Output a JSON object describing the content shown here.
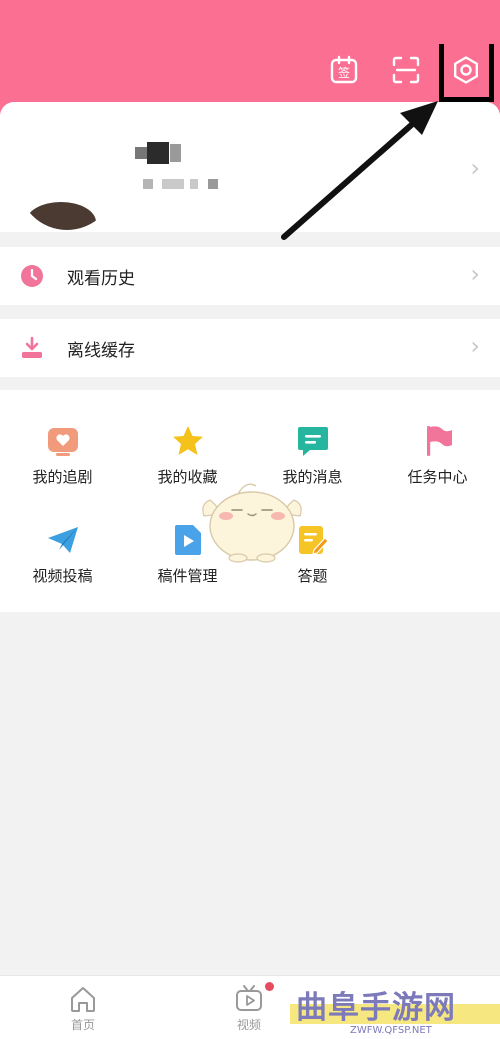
{
  "colors": {
    "accent": "#fb6f93",
    "watermark": "#7d7aba"
  },
  "header": {
    "icons": [
      "sign-in-calendar-icon",
      "scan-icon",
      "gear-icon"
    ]
  },
  "sign_in": {
    "glyph": "签"
  },
  "list": [
    {
      "label": "观看历史",
      "icon": "clock-icon"
    },
    {
      "label": "离线缓存",
      "icon": "download-icon"
    }
  ],
  "grid": [
    {
      "label": "我的追剧",
      "icon": "tv-heart-icon"
    },
    {
      "label": "我的收藏",
      "icon": "star-icon"
    },
    {
      "label": "我的消息",
      "icon": "message-icon"
    },
    {
      "label": "任务中心",
      "icon": "flag-icon"
    },
    {
      "label": "视频投稿",
      "icon": "paper-plane-icon"
    },
    {
      "label": "稿件管理",
      "icon": "video-file-icon"
    },
    {
      "label": "答题",
      "icon": "quiz-icon"
    }
  ],
  "tabbar": {
    "home": "首页",
    "video": "视频"
  },
  "watermark": {
    "title": "曲阜手游网",
    "url": "ZWFW.QFSP.NET"
  }
}
